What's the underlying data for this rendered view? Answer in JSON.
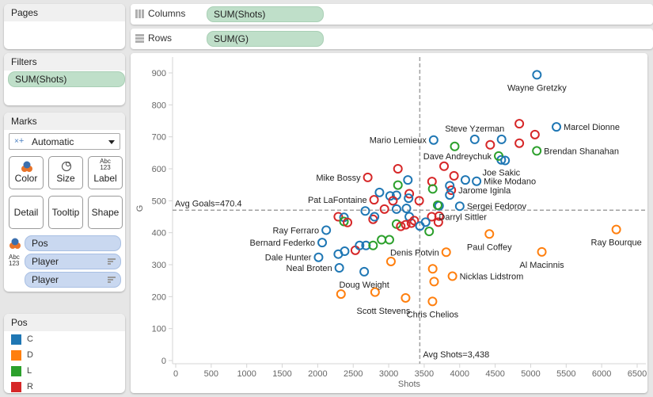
{
  "pages": {
    "title": "Pages"
  },
  "filters": {
    "title": "Filters",
    "items": [
      "SUM(Shots)"
    ]
  },
  "shelves": {
    "columns": {
      "label": "Columns",
      "pill": "SUM(Shots)"
    },
    "rows": {
      "label": "Rows",
      "pill": "SUM(G)"
    }
  },
  "marks": {
    "title": "Marks",
    "type": "Automatic",
    "buttons": [
      "Color",
      "Size",
      "Label",
      "Detail",
      "Tooltip",
      "Shape"
    ],
    "label_icon_text": [
      "Abc",
      "123"
    ],
    "fields": [
      {
        "encoding": "color",
        "name": "Pos"
      },
      {
        "encoding": "label",
        "name": "Player"
      },
      {
        "encoding": "label",
        "name": "Player"
      }
    ]
  },
  "legend": {
    "title": "Pos",
    "items": [
      {
        "label": "C",
        "color": "#1f77b4"
      },
      {
        "label": "D",
        "color": "#ff7f0e"
      },
      {
        "label": "L",
        "color": "#2ca02c"
      },
      {
        "label": "R",
        "color": "#d62728"
      }
    ]
  },
  "chart_data": {
    "type": "scatter",
    "title": "",
    "xlabel": "Shots",
    "ylabel": "G",
    "xlim": [
      0,
      6500
    ],
    "ylim": [
      0,
      900
    ],
    "xticks": [
      0,
      500,
      1000,
      1500,
      2000,
      2500,
      3000,
      3500,
      4000,
      4500,
      5000,
      5500,
      6000,
      6500
    ],
    "yticks": [
      0,
      100,
      200,
      300,
      400,
      500,
      600,
      700,
      800,
      900
    ],
    "grid": false,
    "legend": "right-panel",
    "colors": {
      "C": "#1f77b4",
      "D": "#ff7f0e",
      "L": "#2ca02c",
      "R": "#d62728"
    },
    "reference_lines": [
      {
        "axis": "y",
        "value": 470.4,
        "label": "Avg Goals=470.4"
      },
      {
        "axis": "x",
        "value": 3438,
        "label": "Avg Shots=3,438"
      }
    ],
    "points": [
      {
        "x": 5088,
        "y": 894,
        "pos": "C",
        "label": "Wayne Gretzky",
        "lpos": "below"
      },
      {
        "x": 5363,
        "y": 731,
        "pos": "C",
        "label": "Marcel Dionne",
        "lpos": "right"
      },
      {
        "x": 5086,
        "y": 656,
        "pos": "L",
        "label": "Brendan Shanahan",
        "lpos": "right"
      },
      {
        "x": 4212,
        "y": 692,
        "pos": "C",
        "label": "Steve Yzerman",
        "lpos": "above"
      },
      {
        "x": 3633,
        "y": 690,
        "pos": "C",
        "label": "Mario Lemieux",
        "lpos": "left"
      },
      {
        "x": 4586,
        "y": 628,
        "pos": "C",
        "label": "Joe Sakic",
        "lpos": "below"
      },
      {
        "x": 4549,
        "y": 640,
        "pos": "L",
        "label": "Dave Andreychuk",
        "lpos": "left"
      },
      {
        "x": 4238,
        "y": 561,
        "pos": "C",
        "label": "Mike Modano",
        "lpos": "right"
      },
      {
        "x": 3882,
        "y": 533,
        "pos": "R",
        "label": "Jarome Iginla",
        "lpos": "right"
      },
      {
        "x": 4001,
        "y": 483,
        "pos": "C",
        "label": "Sergei Fedorov",
        "lpos": "right"
      },
      {
        "x": 3710,
        "y": 484,
        "pos": "C",
        "label": "",
        "lpos": ""
      },
      {
        "x": 3606,
        "y": 450,
        "pos": "R",
        "label": "Darryl Sittler",
        "lpos": "right"
      },
      {
        "x": 2705,
        "y": 573,
        "pos": "R",
        "label": "Mike Bossy",
        "lpos": "left"
      },
      {
        "x": 2794,
        "y": 503,
        "pos": "R",
        "label": "Pat LaFontaine",
        "lpos": "left"
      },
      {
        "x": 2120,
        "y": 408,
        "pos": "C",
        "label": "Ray Ferraro",
        "lpos": "left"
      },
      {
        "x": 2063,
        "y": 369,
        "pos": "C",
        "label": "Bernard Federko",
        "lpos": "left"
      },
      {
        "x": 2012,
        "y": 323,
        "pos": "C",
        "label": "Dale Hunter",
        "lpos": "left"
      },
      {
        "x": 2304,
        "y": 290,
        "pos": "C",
        "label": "Neal Broten",
        "lpos": "left"
      },
      {
        "x": 2655,
        "y": 278,
        "pos": "C",
        "label": "Doug Weight",
        "lpos": "below"
      },
      {
        "x": 3810,
        "y": 339,
        "pos": "D",
        "label": "Denis Potvin",
        "lpos": "left"
      },
      {
        "x": 4418,
        "y": 396,
        "pos": "D",
        "label": "Paul Coffey",
        "lpos": "below"
      },
      {
        "x": 6206,
        "y": 410,
        "pos": "D",
        "label": "Ray Bourque",
        "lpos": "below"
      },
      {
        "x": 5157,
        "y": 340,
        "pos": "D",
        "label": "Al Macinnis",
        "lpos": "below"
      },
      {
        "x": 3898,
        "y": 264,
        "pos": "D",
        "label": "Nicklas Lidstrom",
        "lpos": "right"
      },
      {
        "x": 3238,
        "y": 196,
        "pos": "D",
        "label": "Scott Stevens",
        "lpos": "belowleft"
      },
      {
        "x": 3617,
        "y": 185,
        "pos": "D",
        "label": "Chris Chelios",
        "lpos": "below"
      },
      {
        "x": 2328,
        "y": 208,
        "pos": "D",
        "label": "",
        "lpos": ""
      },
      {
        "x": 2808,
        "y": 214,
        "pos": "D",
        "label": "",
        "lpos": ""
      },
      {
        "x": 3032,
        "y": 310,
        "pos": "D",
        "label": "",
        "lpos": ""
      },
      {
        "x": 3620,
        "y": 287,
        "pos": "D",
        "label": "",
        "lpos": ""
      },
      {
        "x": 3640,
        "y": 247,
        "pos": "D",
        "label": "",
        "lpos": ""
      },
      {
        "x": 4840,
        "y": 741,
        "pos": "R",
        "label": "",
        "lpos": ""
      },
      {
        "x": 5060,
        "y": 707,
        "pos": "R",
        "label": "",
        "lpos": ""
      },
      {
        "x": 4840,
        "y": 680,
        "pos": "R",
        "label": "",
        "lpos": ""
      },
      {
        "x": 4430,
        "y": 675,
        "pos": "R",
        "label": "",
        "lpos": ""
      },
      {
        "x": 4590,
        "y": 692,
        "pos": "C",
        "label": "",
        "lpos": ""
      },
      {
        "x": 4640,
        "y": 626,
        "pos": "C",
        "label": "",
        "lpos": ""
      },
      {
        "x": 3930,
        "y": 670,
        "pos": "L",
        "label": "",
        "lpos": ""
      },
      {
        "x": 3780,
        "y": 608,
        "pos": "R",
        "label": "",
        "lpos": ""
      },
      {
        "x": 3920,
        "y": 578,
        "pos": "R",
        "label": "",
        "lpos": ""
      },
      {
        "x": 4080,
        "y": 565,
        "pos": "C",
        "label": "",
        "lpos": ""
      },
      {
        "x": 3860,
        "y": 547,
        "pos": "C",
        "label": "",
        "lpos": ""
      },
      {
        "x": 3860,
        "y": 518,
        "pos": "C",
        "label": "",
        "lpos": ""
      },
      {
        "x": 3610,
        "y": 560,
        "pos": "R",
        "label": "",
        "lpos": ""
      },
      {
        "x": 3620,
        "y": 537,
        "pos": "L",
        "label": "",
        "lpos": ""
      },
      {
        "x": 3690,
        "y": 486,
        "pos": "L",
        "label": "",
        "lpos": ""
      },
      {
        "x": 3130,
        "y": 600,
        "pos": "R",
        "label": "",
        "lpos": ""
      },
      {
        "x": 3130,
        "y": 549,
        "pos": "L",
        "label": "",
        "lpos": ""
      },
      {
        "x": 3270,
        "y": 565,
        "pos": "C",
        "label": "",
        "lpos": ""
      },
      {
        "x": 3430,
        "y": 500,
        "pos": "R",
        "label": "",
        "lpos": ""
      },
      {
        "x": 2870,
        "y": 526,
        "pos": "C",
        "label": "",
        "lpos": ""
      },
      {
        "x": 3020,
        "y": 515,
        "pos": "C",
        "label": "",
        "lpos": ""
      },
      {
        "x": 3110,
        "y": 517,
        "pos": "C",
        "label": "",
        "lpos": ""
      },
      {
        "x": 3290,
        "y": 522,
        "pos": "R",
        "label": "",
        "lpos": ""
      },
      {
        "x": 3280,
        "y": 508,
        "pos": "C",
        "label": "",
        "lpos": ""
      },
      {
        "x": 3060,
        "y": 500,
        "pos": "R",
        "label": "",
        "lpos": ""
      },
      {
        "x": 2670,
        "y": 468,
        "pos": "C",
        "label": "",
        "lpos": ""
      },
      {
        "x": 2940,
        "y": 474,
        "pos": "R",
        "label": "",
        "lpos": ""
      },
      {
        "x": 3110,
        "y": 474,
        "pos": "C",
        "label": "",
        "lpos": ""
      },
      {
        "x": 3250,
        "y": 476,
        "pos": "C",
        "label": "",
        "lpos": ""
      },
      {
        "x": 3290,
        "y": 450,
        "pos": "C",
        "label": "",
        "lpos": ""
      },
      {
        "x": 3710,
        "y": 452,
        "pos": "R",
        "label": "",
        "lpos": ""
      },
      {
        "x": 3700,
        "y": 433,
        "pos": "R",
        "label": "",
        "lpos": ""
      },
      {
        "x": 2290,
        "y": 450,
        "pos": "R",
        "label": "",
        "lpos": ""
      },
      {
        "x": 2370,
        "y": 448,
        "pos": "C",
        "label": "",
        "lpos": ""
      },
      {
        "x": 2370,
        "y": 435,
        "pos": "L",
        "label": "",
        "lpos": ""
      },
      {
        "x": 2420,
        "y": 432,
        "pos": "R",
        "label": "",
        "lpos": ""
      },
      {
        "x": 2780,
        "y": 442,
        "pos": "R",
        "label": "",
        "lpos": ""
      },
      {
        "x": 2800,
        "y": 450,
        "pos": "C",
        "label": "",
        "lpos": ""
      },
      {
        "x": 3110,
        "y": 427,
        "pos": "L",
        "label": "",
        "lpos": ""
      },
      {
        "x": 3170,
        "y": 420,
        "pos": "R",
        "label": "",
        "lpos": ""
      },
      {
        "x": 3240,
        "y": 425,
        "pos": "R",
        "label": "",
        "lpos": ""
      },
      {
        "x": 3320,
        "y": 430,
        "pos": "R",
        "label": "",
        "lpos": ""
      },
      {
        "x": 3360,
        "y": 438,
        "pos": "R",
        "label": "",
        "lpos": ""
      },
      {
        "x": 3440,
        "y": 421,
        "pos": "C",
        "label": "",
        "lpos": ""
      },
      {
        "x": 3520,
        "y": 433,
        "pos": "C",
        "label": "",
        "lpos": ""
      },
      {
        "x": 3570,
        "y": 404,
        "pos": "L",
        "label": "",
        "lpos": ""
      },
      {
        "x": 2290,
        "y": 333,
        "pos": "C",
        "label": "",
        "lpos": ""
      },
      {
        "x": 2380,
        "y": 342,
        "pos": "C",
        "label": "",
        "lpos": ""
      },
      {
        "x": 2530,
        "y": 345,
        "pos": "R",
        "label": "",
        "lpos": ""
      },
      {
        "x": 2590,
        "y": 360,
        "pos": "C",
        "label": "",
        "lpos": ""
      },
      {
        "x": 2680,
        "y": 360,
        "pos": "C",
        "label": "",
        "lpos": ""
      },
      {
        "x": 2780,
        "y": 360,
        "pos": "L",
        "label": "",
        "lpos": ""
      },
      {
        "x": 2900,
        "y": 378,
        "pos": "L",
        "label": "",
        "lpos": ""
      },
      {
        "x": 3010,
        "y": 378,
        "pos": "L",
        "label": "",
        "lpos": ""
      }
    ]
  }
}
